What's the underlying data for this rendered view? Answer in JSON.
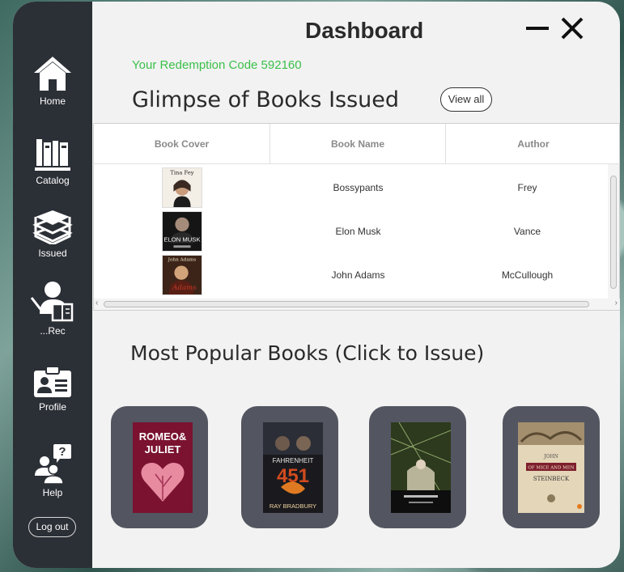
{
  "sidebar": {
    "items": [
      {
        "label": "Home",
        "icon": "home-icon"
      },
      {
        "label": "Catalog",
        "icon": "books-shelf-icon"
      },
      {
        "label": "Issued",
        "icon": "book-stack-icon"
      },
      {
        "label": "...Rec",
        "icon": "teacher-board-icon"
      },
      {
        "label": "Profile",
        "icon": "id-card-icon"
      },
      {
        "label": "Help",
        "icon": "help-people-icon"
      }
    ],
    "logout_label": "Log out"
  },
  "header": {
    "title": "Dashboard"
  },
  "redemption": {
    "text": "Your Redemption Code 592160",
    "color": "#3cc04a"
  },
  "issued": {
    "title": "Glimpse of Books Issued",
    "view_all_label": "View all",
    "columns": [
      "Book Cover",
      "Book Name",
      "Author"
    ],
    "rows": [
      {
        "cover_text": "Tina Fey",
        "name": "Bossypants",
        "author": "Frey"
      },
      {
        "cover_text": "ELON MUSK",
        "name": "Elon Musk",
        "author": "Vance"
      },
      {
        "cover_text": "John Adams",
        "name": "John Adams",
        "author": "McCullough"
      }
    ]
  },
  "popular": {
    "title": "Most Popular Books (Click to Issue)",
    "books": [
      {
        "cover_title": "ROMEO & JULIET"
      },
      {
        "cover_title": "FAHRENHEIT 451",
        "cover_author": "RAY BRADBURY"
      },
      {
        "cover_title": ""
      },
      {
        "cover_title": "OF MICE AND MEN",
        "cover_author": "JOHN STEINBECK"
      }
    ]
  },
  "colors": {
    "sidebar": "#2b2f36",
    "card": "#535660",
    "accent_green": "#3cc04a"
  }
}
